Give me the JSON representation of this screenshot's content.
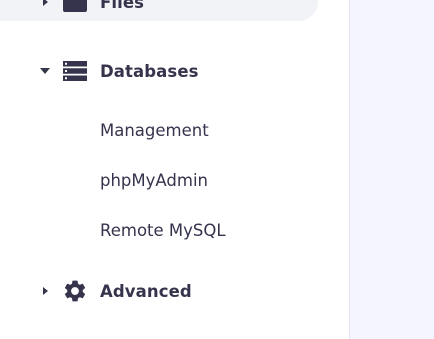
{
  "sidebar": {
    "files": {
      "label": "Files",
      "icon": "folder-icon",
      "expanded": false
    },
    "databases": {
      "label": "Databases",
      "icon": "database-icon",
      "expanded": true,
      "items": [
        {
          "label": "Management"
        },
        {
          "label": "phpMyAdmin"
        },
        {
          "label": "Remote MySQL"
        }
      ]
    },
    "advanced": {
      "label": "Advanced",
      "icon": "gear-icon",
      "expanded": false
    }
  },
  "colors": {
    "text": "#36344d",
    "icon": "#36344d",
    "active_bg": "#f2f3f6",
    "main_bg": "#f4f5ff"
  }
}
